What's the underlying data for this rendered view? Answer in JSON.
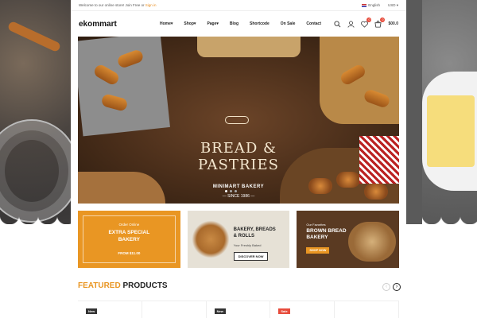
{
  "topbar": {
    "welcome": "Welcome to our online store! Join Free or",
    "signin": "Sign in",
    "language": "English",
    "currency": "USD"
  },
  "nav": {
    "logo": "ekommart",
    "menu": [
      "Home",
      "Shop",
      "Page",
      "Blog",
      "Shortcode",
      "On Sale",
      "Contact"
    ],
    "wishlist_count": "0",
    "cart_count": "0",
    "cart_total": "$00.0"
  },
  "hero": {
    "title_line1": "BREAD &",
    "title_line2": "PASTRIES",
    "subtitle": "MINIMART BAKERY",
    "since": "SINCE 1986"
  },
  "banners": [
    {
      "small": "Order Online",
      "title_line1": "EXTRA SPECIAL",
      "title_line2": "BAKERY",
      "from": "FROM $11.00"
    },
    {
      "title_line1": "BAKERY, BREADS",
      "title_line2": "& ROLLS",
      "small": "Your Freshly Baked",
      "button": "DISCOVER NOW"
    },
    {
      "small": "Our Favorites",
      "title_line1": "BROWN BREAD",
      "title_line2": "BAKERY",
      "button": "SHOP NOW"
    }
  ],
  "featured": {
    "highlight": "FEATURED",
    "rest": "PRODUCTS"
  },
  "products": [
    {
      "tag": "New",
      "tag_type": "new"
    },
    {
      "tag": "",
      "tag_type": ""
    },
    {
      "tag": "New",
      "tag_type": "new"
    },
    {
      "tag": "Sale",
      "tag_type": "sale"
    },
    {
      "tag": "",
      "tag_type": ""
    }
  ],
  "colors": {
    "accent": "#e99623",
    "badge": "#e74c3c"
  }
}
